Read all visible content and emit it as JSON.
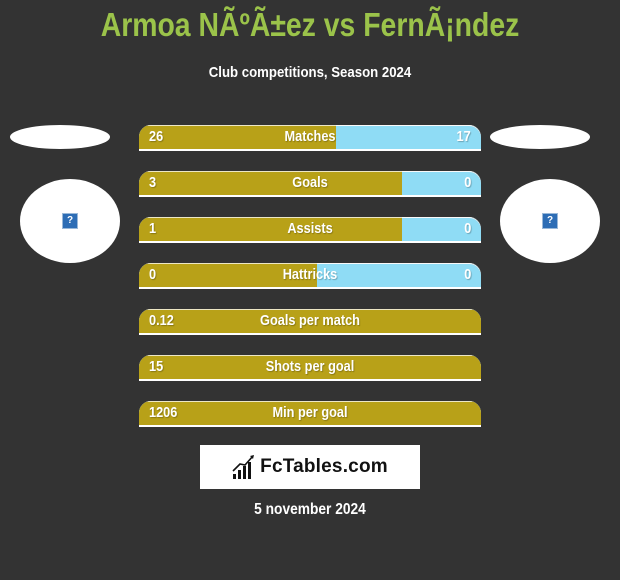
{
  "header": {
    "title": "Armoa NÃºÃ±ez vs FernÃ¡ndez",
    "subtitle": "Club competitions, Season 2024"
  },
  "players": {
    "left": {
      "avatar_icon": "question-mark-icon",
      "avatar_glyph": "?"
    },
    "right": {
      "avatar_icon": "question-mark-icon",
      "avatar_glyph": "?"
    }
  },
  "colors": {
    "left_bar": "#b8a118",
    "right_bar": "#8fdcf5",
    "title": "#9bc34a",
    "background": "#333333"
  },
  "stats": [
    {
      "label": "Matches",
      "left": "26",
      "right": "17",
      "left_share": 0.576
    },
    {
      "label": "Goals",
      "left": "3",
      "right": "0",
      "left_share": 0.77
    },
    {
      "label": "Assists",
      "left": "1",
      "right": "0",
      "left_share": 0.77
    },
    {
      "label": "Hattricks",
      "left": "0",
      "right": "0",
      "left_share": 0.52
    },
    {
      "label": "Goals per match",
      "left": "0.12",
      "right": "",
      "left_share": 1.0
    },
    {
      "label": "Shots per goal",
      "left": "15",
      "right": "",
      "left_share": 1.0
    },
    {
      "label": "Min per goal",
      "left": "1206",
      "right": "",
      "left_share": 1.0
    }
  ],
  "footer": {
    "logo_text": "FcTables.com",
    "logo_icon": "bar-chart-icon",
    "date": "5 november 2024"
  }
}
